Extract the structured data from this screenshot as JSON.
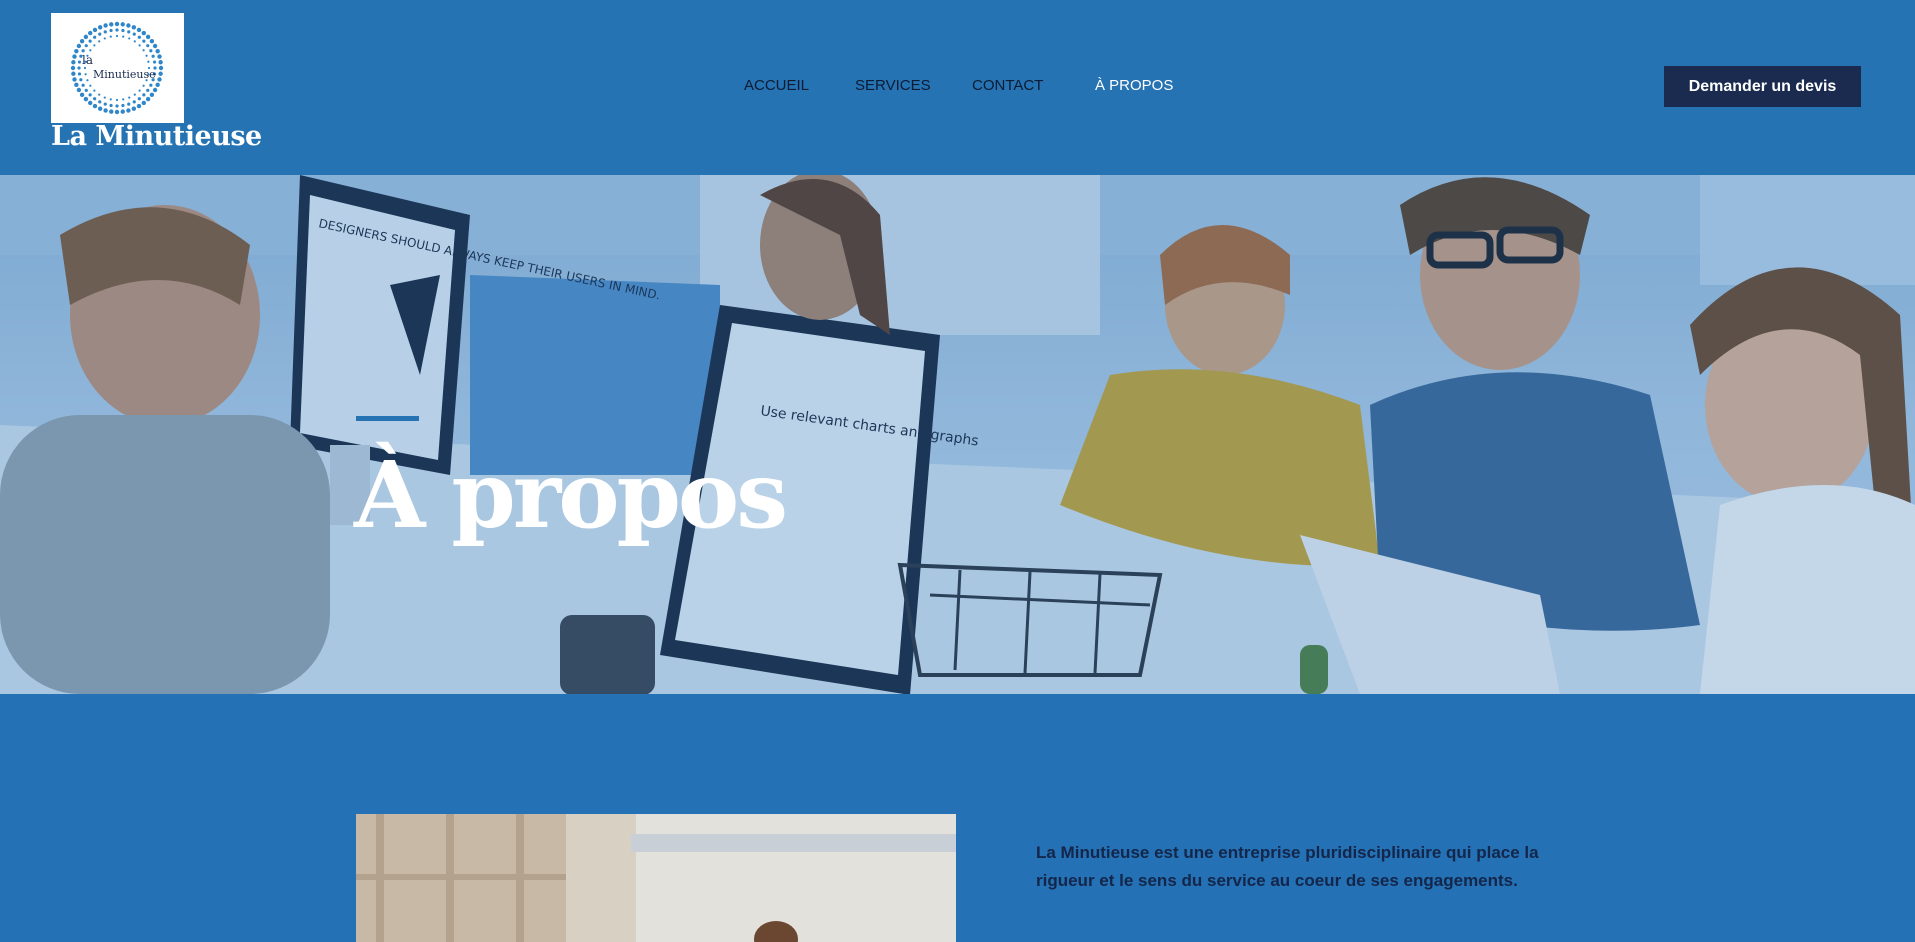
{
  "brand": {
    "logo_text_la": "la",
    "logo_text_main": "Minutieuse",
    "name": "La Minutieuse"
  },
  "nav": {
    "items": [
      {
        "label": "ACCUEIL",
        "active": false
      },
      {
        "label": "SERVICES",
        "active": false
      },
      {
        "label": "CONTACT",
        "active": false
      },
      {
        "label": "À PROPOS",
        "active": true
      }
    ]
  },
  "header": {
    "cta_label": "Demander un devis"
  },
  "hero": {
    "title": "À propos",
    "screen_text_left": "DESIGNERS SHOULD ALWAYS KEEP THEIR USERS IN MIND.",
    "screen_text_center": "Use relevant charts and graphs"
  },
  "about": {
    "paragraph": "La Minutieuse est une entreprise pluridisciplinaire qui place la rigueur et le sens  du service  au coeur de ses engagements."
  },
  "colors": {
    "header_bg": "#2573b3",
    "page_bg": "#2471b5",
    "cta_bg": "#1a2b4f",
    "nav_text": "#0d1b33",
    "accent": "#2573b3"
  }
}
